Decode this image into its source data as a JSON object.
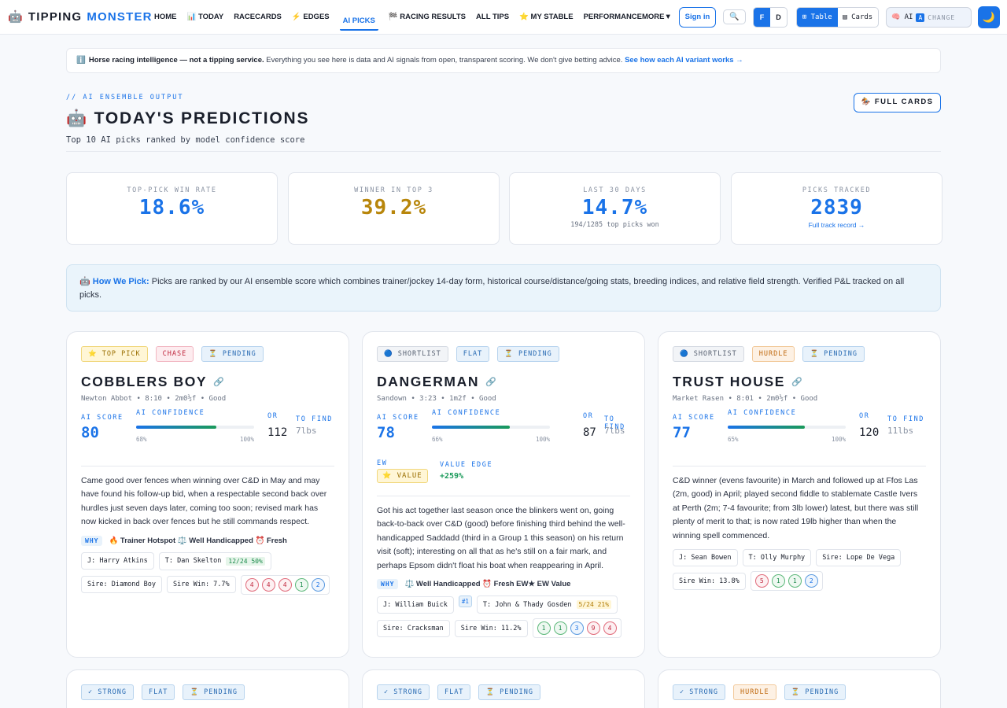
{
  "brand": {
    "icon": "🤖",
    "part1": "TIPPING",
    "part2": "MONSTER"
  },
  "nav": {
    "links": [
      {
        "label": "HOME"
      },
      {
        "label": "📊 TODAY"
      },
      {
        "label": "RACECARDS"
      },
      {
        "label": "⚡ EDGES"
      },
      {
        "label": "AI PICKS"
      },
      {
        "label": "🏁 RACING RESULTS"
      },
      {
        "label": "ALL TIPS"
      },
      {
        "label": "⭐ MY STABLE"
      },
      {
        "label": "PERFORMANCE"
      }
    ],
    "more": "MORE▼",
    "signin": "Sign in",
    "search_icon": "🔍",
    "odds_f": "F",
    "odds_d": "D",
    "view_table": "⊞ Table",
    "view_cards": "▤ Cards",
    "ai_label": "🧠 AI",
    "ai_badge": "A",
    "change": "CHANGE",
    "theme_icon": "🌙"
  },
  "banner": {
    "icon": "ℹ️",
    "bold": "Horse racing intelligence — not a tipping service.",
    "text": " Everything you see here is data and AI signals from open, transparent scoring. We don't give betting advice. ",
    "link": "See how each AI variant works →"
  },
  "header": {
    "eyebrow": "// AI ENSEMBLE OUTPUT",
    "title": "🤖 TODAY'S PREDICTIONS",
    "subtitle": "Top 10 AI picks ranked by model confidence score",
    "full_cards": "🏇 FULL CARDS"
  },
  "stats": [
    {
      "label": "TOP-PICK WIN RATE",
      "value": "18.6%",
      "color": "#1a73e8"
    },
    {
      "label": "WINNER IN TOP 3",
      "value": "39.2%",
      "color": "#b8860b"
    },
    {
      "label": "LAST 30 DAYS",
      "value": "14.7%",
      "color": "#1a73e8",
      "sub": "194/1285 top picks won"
    },
    {
      "label": "PICKS TRACKED",
      "value": "2839",
      "color": "#1a73e8",
      "link": "Full track record →"
    }
  ],
  "how_we_pick": {
    "bold": "🤖 How We Pick:",
    "text": " Picks are ranked by our AI ensemble score which combines trainer/jockey 14-day form, historical course/distance/going stats, breeding indices, and relative field strength. Verified P&L tracked on all picks."
  },
  "labels": {
    "ai_score": "AI SCORE",
    "ai_confidence": "AI CONFIDENCE",
    "or": "OR",
    "to_find": "TO FIND",
    "why": "WHY",
    "ew": "EW",
    "value_edge": "VALUE EDGE",
    "bar_hi": "100%",
    "link_icon": "🔗"
  },
  "cards": [
    {
      "tags": [
        "⭐ TOP PICK",
        "CHASE",
        "⏳ PENDING"
      ],
      "horse": "COBBLERS BOY",
      "race": "Newton Abbot • 8:10 • 2m0½f • Good",
      "ai_score": "80",
      "confidence": "68%",
      "confidence_pct": 68,
      "or": "112",
      "to_find": "7lbs",
      "desc": "Came good over fences when winning over C&D in May and may have found his follow-up bid, when a respectable second back over hurdles just seven days later, coming too soon; revised mark has now kicked in back over fences but he still commands respect.",
      "why": "🔥 Trainer Hotspot ⚖️ Well Handicapped ⏰ Fresh",
      "jockey": "J: Harry Atkins",
      "trainer": "T: Dan Skelton",
      "trainer_stat": "12/24 50%",
      "sire": "Sire: Diamond Boy",
      "sire_win": "Sire Win: 7.7%",
      "form": [
        "4",
        "4",
        "4",
        "1",
        "2"
      ]
    },
    {
      "tags": [
        "🔵 SHORTLIST",
        "FLAT",
        "⏳ PENDING"
      ],
      "horse": "DANGERMAN",
      "race": "Sandown • 3:23 • 1m2f • Good",
      "ai_score": "78",
      "confidence": "66%",
      "confidence_pct": 66,
      "or": "87",
      "to_find": "7lbs",
      "value_badge": "⭐ VALUE",
      "value_edge": "+259%",
      "desc": "Got his act together last season once the blinkers went on, going back-to-back over C&D (good) before finishing third behind the well-handicapped Saddadd (third in a Group 1 this season) on his return visit (soft); interesting on all that as he's still on a fair mark, and perhaps Epsom didn't float his boat when reappearing in April.",
      "why": "⚖️ Well Handicapped ⏰ Fresh EW★ EW Value",
      "jockey": "J: William Buick",
      "rank": "#1",
      "trainer": "T: John & Thady Gosden",
      "trainer_stat": "5/24 21%",
      "sire": "Sire: Cracksman",
      "sire_win": "Sire Win: 11.2%",
      "form": [
        "1",
        "1",
        "3",
        "9",
        "4"
      ]
    },
    {
      "tags": [
        "🔵 SHORTLIST",
        "HURDLE",
        "⏳ PENDING"
      ],
      "horse": "TRUST HOUSE",
      "race": "Market Rasen • 8:01 • 2m0½f • Good",
      "ai_score": "77",
      "confidence": "65%",
      "confidence_pct": 65,
      "or": "120",
      "to_find": "11lbs",
      "desc": "C&D winner (evens favourite) in March and followed up at Ffos Las (2m, good) in April; played second fiddle to stablemate Castle Ivers at Perth (2m; 7-4 favourite; from 3lb lower) latest, but there was still plenty of merit to that; is now rated 19lb higher than when the winning spell commenced.",
      "jockey": "J: Sean Bowen",
      "trainer": "T: Olly Murphy",
      "sire": "Sire: Lope De Vega",
      "sire_win": "Sire Win: 13.8%",
      "form": [
        "5",
        "1",
        "1",
        "2"
      ]
    }
  ],
  "next_row_tags": [
    [
      "✓ STRONG",
      "FLAT",
      "⏳ PENDING"
    ],
    [
      "✓ STRONG",
      "FLAT",
      "⏳ PENDING"
    ],
    [
      "✓ STRONG",
      "HURDLE",
      "⏳ PENDING"
    ]
  ]
}
